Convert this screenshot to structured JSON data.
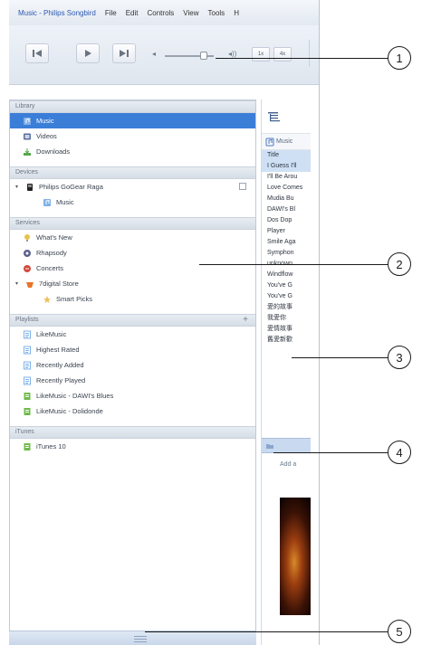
{
  "menubar": {
    "title": "Music - Philips Songbird",
    "menus": [
      "File",
      "Edit",
      "Controls",
      "View",
      "Tools",
      "H"
    ]
  },
  "toolbar": {
    "buttons": [
      {
        "name": "previous",
        "icon": "previous-icon"
      },
      {
        "name": "play",
        "icon": "play-icon"
      },
      {
        "name": "next",
        "icon": "next-icon"
      }
    ],
    "volume_level": 0.8,
    "small_buttons": [
      "1x",
      "4x"
    ]
  },
  "sidebar": {
    "sections": [
      {
        "key": "library",
        "title": "Library",
        "items": [
          {
            "label": "Music",
            "icon": "music-icon",
            "color": "#7fb0e8",
            "selected": true
          },
          {
            "label": "Videos",
            "icon": "video-icon",
            "color": "#5b6f9b"
          },
          {
            "label": "Downloads",
            "icon": "download-icon",
            "color": "#55a84a"
          }
        ]
      },
      {
        "key": "devices",
        "title": "Devices",
        "items": [
          {
            "label": "Philips GoGear Raga",
            "icon": "device-icon",
            "color": "#222222",
            "expander": "▾"
          },
          {
            "label": "Music",
            "icon": "music-icon",
            "color": "#7fb0e8",
            "sub": true
          }
        ]
      },
      {
        "key": "services",
        "title": "Services",
        "items": [
          {
            "label": "What's New",
            "icon": "lightbulb-icon",
            "color": "#e8c24a"
          },
          {
            "label": "Rhapsody",
            "icon": "rhapsody-icon",
            "color": "#5a5f8e"
          },
          {
            "label": "Concerts",
            "icon": "concerts-icon",
            "color": "#d24a3a"
          },
          {
            "label": "7digital Store",
            "icon": "store-icon",
            "color": "#e8742a",
            "expander": "▾"
          },
          {
            "label": "Smart Picks",
            "icon": "smart-picks-icon",
            "color": "#f0c060",
            "sub": true
          }
        ]
      },
      {
        "key": "playlists",
        "title": "Playlists",
        "add_label": "+",
        "items": [
          {
            "label": "LikeMusic",
            "icon": "playlist-icon",
            "color": "#7fb0e8"
          },
          {
            "label": "Highest Rated",
            "icon": "playlist-icon",
            "color": "#7fb0e8"
          },
          {
            "label": "Recently Added",
            "icon": "playlist-icon",
            "color": "#7fb0e8"
          },
          {
            "label": "Recently Played",
            "icon": "playlist-icon",
            "color": "#7fb0e8"
          },
          {
            "label": "LikeMusic - DAWI's Blues",
            "icon": "smart-playlist-icon",
            "color": "#6dbb4a"
          },
          {
            "label": "LikeMusic - Dolidonde",
            "icon": "smart-playlist-icon",
            "color": "#6dbb4a"
          }
        ]
      },
      {
        "key": "itunes",
        "title": "iTunes",
        "items": [
          {
            "label": "iTunes 10",
            "icon": "itunes-playlist-icon",
            "color": "#6dbb4a"
          }
        ]
      }
    ]
  },
  "content": {
    "column_header": "Music",
    "tracks": [
      {
        "title": "Title",
        "hl": true
      },
      {
        "title": "I Guess I'll",
        "hl": true
      },
      {
        "title": "I'll Be Arou",
        "hl": false
      },
      {
        "title": "Love Comes",
        "hl": false
      },
      {
        "title": "Mudia Bu",
        "hl": false
      },
      {
        "title": "DAWI's Bl",
        "hl": false
      },
      {
        "title": "Dos Dop",
        "hl": false
      },
      {
        "title": "Player",
        "hl": false
      },
      {
        "title": "Smile Aga",
        "hl": false
      },
      {
        "title": "Symphon",
        "hl": false
      },
      {
        "title": "unknown",
        "hl": false
      },
      {
        "title": "Windflow",
        "hl": false
      },
      {
        "title": "You've G",
        "hl": false
      },
      {
        "title": "You've G",
        "hl": false
      },
      {
        "title": "愛的故事",
        "hl": false
      },
      {
        "title": "我愛你",
        "hl": false
      },
      {
        "title": "愛情故事",
        "hl": false
      },
      {
        "title": "舊愛新歡",
        "hl": false
      }
    ],
    "add_label": "Add a"
  },
  "callouts": [
    "1",
    "2",
    "3",
    "4",
    "5"
  ]
}
